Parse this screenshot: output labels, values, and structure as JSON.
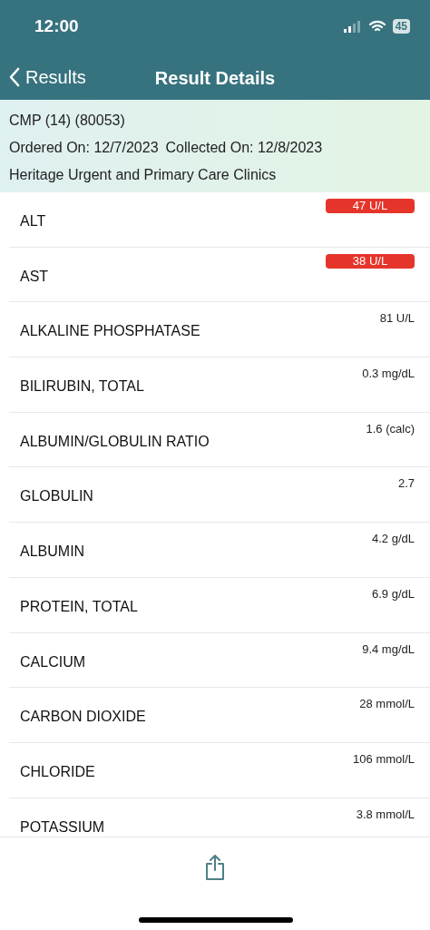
{
  "status_bar": {
    "time": "12:00",
    "battery": "45"
  },
  "nav": {
    "back": "Results",
    "title": "Result Details"
  },
  "header": {
    "test": "CMP (14) (80053)",
    "ordered": "Ordered On: 12/7/2023",
    "collected": "Collected On: 12/8/2023",
    "clinic": "Heritage Urgent and Primary Care Clinics"
  },
  "results": [
    {
      "name": "ALT",
      "value": "47 U/L",
      "flagged": true
    },
    {
      "name": "AST",
      "value": "38 U/L",
      "flagged": true
    },
    {
      "name": "ALKALINE PHOSPHATASE",
      "value": "81 U/L",
      "flagged": false
    },
    {
      "name": "BILIRUBIN, TOTAL",
      "value": "0.3 mg/dL",
      "flagged": false
    },
    {
      "name": "ALBUMIN/GLOBULIN RATIO",
      "value": "1.6 (calc)",
      "flagged": false
    },
    {
      "name": "GLOBULIN",
      "value": "2.7",
      "flagged": false
    },
    {
      "name": "ALBUMIN",
      "value": "4.2 g/dL",
      "flagged": false
    },
    {
      "name": "PROTEIN, TOTAL",
      "value": "6.9 g/dL",
      "flagged": false
    },
    {
      "name": "CALCIUM",
      "value": "9.4 mg/dL",
      "flagged": false
    },
    {
      "name": "CARBON DIOXIDE",
      "value": "28 mmol/L",
      "flagged": false
    },
    {
      "name": "CHLORIDE",
      "value": "106 mmol/L",
      "flagged": false
    },
    {
      "name": "POTASSIUM",
      "value": "3.8 mmol/L",
      "flagged": false
    }
  ]
}
